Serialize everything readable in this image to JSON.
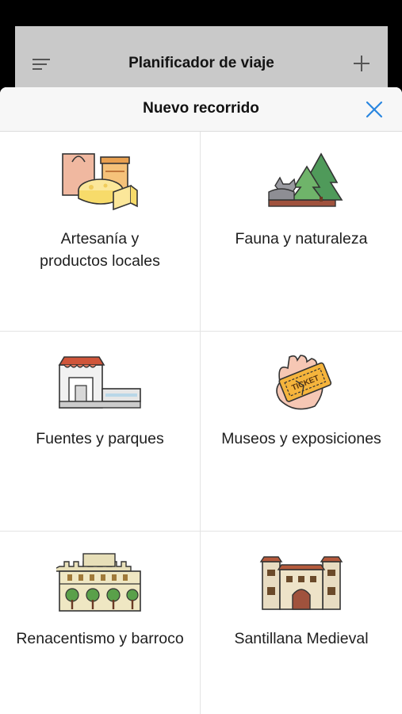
{
  "app": {
    "title": "Planificador de viaje",
    "menu_icon": "hamburger-menu-icon",
    "add_icon": "plus-icon"
  },
  "modal": {
    "title": "Nuevo recorrido",
    "close_icon": "close-icon",
    "accent_color": "#2a86e0"
  },
  "categories": [
    {
      "label_line1": "Artesanía y",
      "label_line2": "productos locales",
      "icon": "crafts-products-icon"
    },
    {
      "label_line1": "Fauna y naturaleza",
      "label_line2": "",
      "icon": "wildlife-nature-icon"
    },
    {
      "label_line1": "Fuentes y parques",
      "label_line2": "",
      "icon": "fountains-parks-icon"
    },
    {
      "label_line1": "Museos y exposiciones",
      "label_line2": "",
      "icon": "museum-ticket-icon"
    },
    {
      "label_line1": "Renacentismo y barroco",
      "label_line2": "",
      "icon": "renaissance-palace-icon"
    },
    {
      "label_line1": "Santillana Medieval",
      "label_line2": "",
      "icon": "medieval-building-icon"
    }
  ]
}
